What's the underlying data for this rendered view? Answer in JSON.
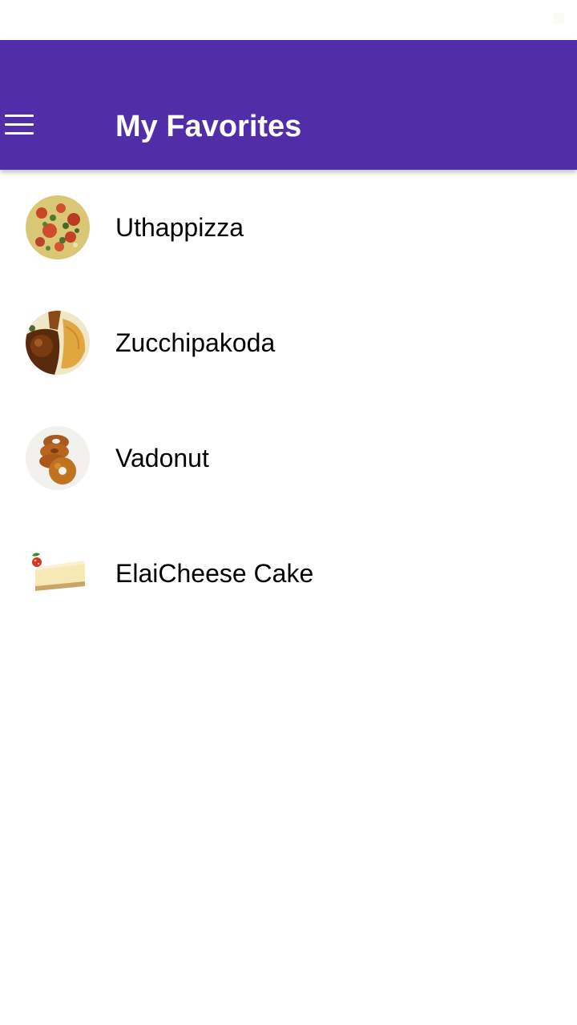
{
  "app_bar": {
    "title": "My Favorites",
    "menu_icon": "hamburger-menu-icon",
    "background": "#512DA8"
  },
  "favorites": [
    {
      "name": "Uthappizza",
      "image": "uthappizza-thumbnail"
    },
    {
      "name": "Zucchipakoda",
      "image": "zucchipakoda-thumbnail"
    },
    {
      "name": "Vadonut",
      "image": "vadonut-thumbnail"
    },
    {
      "name": "ElaiCheese Cake",
      "image": "elaicheese-cake-thumbnail"
    }
  ]
}
